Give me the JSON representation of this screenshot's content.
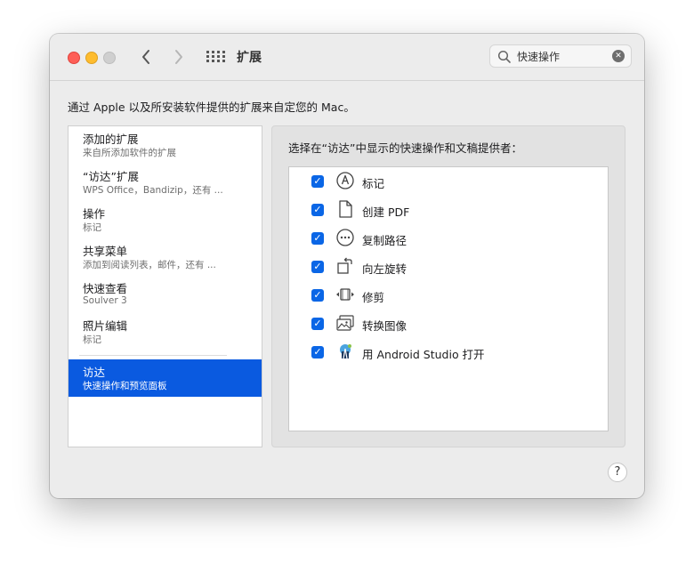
{
  "window": {
    "title": "扩展",
    "search": {
      "value": "快速操作",
      "placeholder": "搜索"
    },
    "description": "通过 Apple 以及所安装软件提供的扩展来自定您的 Mac。",
    "help_label": "?"
  },
  "sidebar": {
    "items": [
      {
        "title": "添加的扩展",
        "subtitle": "来自所添加软件的扩展"
      },
      {
        "title": "“访达”扩展",
        "subtitle": "WPS Office，Bandizip，还有 ..."
      },
      {
        "title": "操作",
        "subtitle": "标记"
      },
      {
        "title": "共享菜单",
        "subtitle": "添加到阅读列表，邮件，还有 ..."
      },
      {
        "title": "快速查看",
        "subtitle": "Soulver 3"
      },
      {
        "title": "照片编辑",
        "subtitle": "标记"
      },
      {
        "title": "访达",
        "subtitle": "快速操作和预览面板",
        "selected": true
      }
    ]
  },
  "panel": {
    "heading": "选择在“访达”中显示的快速操作和文稿提供者：",
    "actions": [
      {
        "label": "标记",
        "icon": "markup-icon",
        "checked": true
      },
      {
        "label": "创建 PDF",
        "icon": "document-icon",
        "checked": true
      },
      {
        "label": "复制路径",
        "icon": "ellipsis-circle-icon",
        "checked": true
      },
      {
        "label": "向左旋转",
        "icon": "rotate-left-icon",
        "checked": true
      },
      {
        "label": "修剪",
        "icon": "trim-icon",
        "checked": true
      },
      {
        "label": "转换图像",
        "icon": "photo-icon",
        "checked": true
      },
      {
        "label": "用 Android Studio 打开",
        "icon": "android-studio-icon",
        "checked": true
      }
    ]
  },
  "colors": {
    "selection": "#0a5ae0",
    "checkbox": "#0a66e6"
  }
}
